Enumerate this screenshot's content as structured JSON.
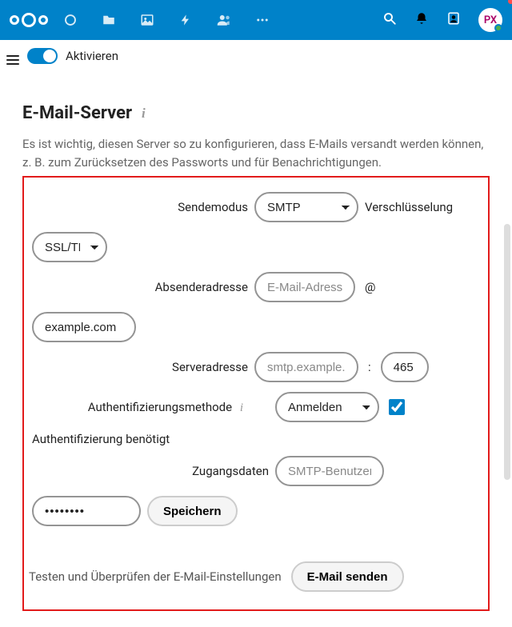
{
  "topbar": {
    "avatar_initials": "PX"
  },
  "toggle": {
    "label": "Aktivieren"
  },
  "section": {
    "title": "E-Mail-Server",
    "description": "Es ist wichtig, diesen Server so zu konfigurieren, dass E-Mails versandt werden können, z. B. zum Zurücksetzen des Passworts und für Benachrichtigungen."
  },
  "form": {
    "sendmode_label": "Sendemodus",
    "sendmode_value": "SMTP",
    "encryption_label": "Verschlüsselung",
    "encryption_value": "SSL/TLS",
    "from_label": "Absenderadresse",
    "from_placeholder": "E-Mail-Adresse",
    "at": "@",
    "domain_value": "example.com",
    "server_label": "Serveradresse",
    "server_placeholder": "smtp.example.com",
    "colon": ":",
    "port_value": "465",
    "authmethod_label": "Authentifizierungsmethode",
    "authmethod_value": "Anmelden",
    "authreq_label": "Authentifizierung benötigt",
    "creds_label": "Zugangsdaten",
    "user_placeholder": "SMTP-Benutzername",
    "pass_value": "********",
    "save_label": "Speichern"
  },
  "test": {
    "label": "Testen und Überprüfen der E-Mail-Einstellungen",
    "button": "E-Mail senden"
  }
}
